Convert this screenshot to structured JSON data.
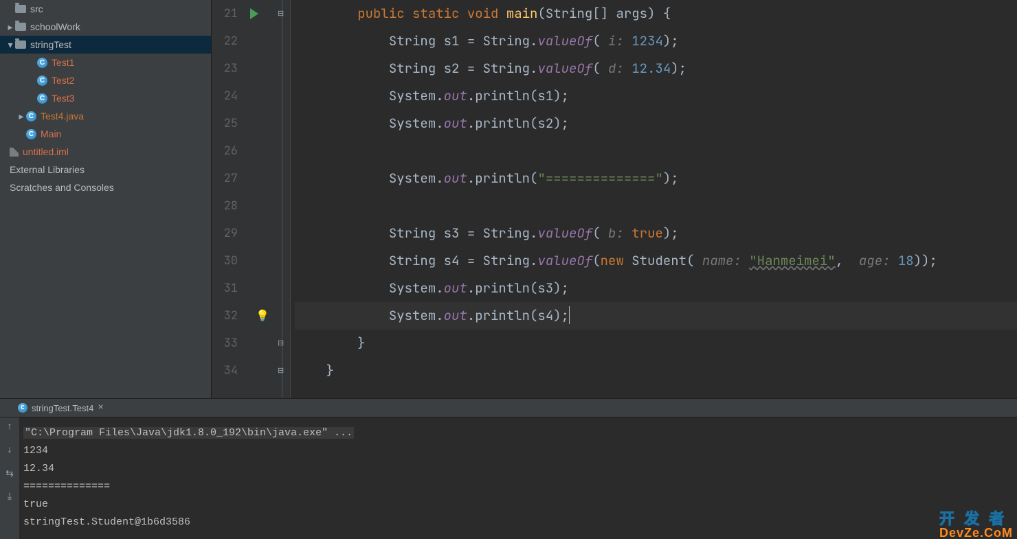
{
  "tree": {
    "items": [
      {
        "indent": 0,
        "arrow": "",
        "icon": "folder",
        "label": "src",
        "class": "plain"
      },
      {
        "indent": 0,
        "arrow": "▸",
        "icon": "folder",
        "label": "schoolWork",
        "class": "plain"
      },
      {
        "indent": 0,
        "arrow": "▾",
        "icon": "folder",
        "label": "stringTest",
        "class": "plain",
        "selected": true
      },
      {
        "indent": 2,
        "arrow": "",
        "icon": "cfile",
        "label": "Test1",
        "class": "fname"
      },
      {
        "indent": 2,
        "arrow": "",
        "icon": "cfile",
        "label": "Test2",
        "class": "fname"
      },
      {
        "indent": 2,
        "arrow": "",
        "icon": "cfile",
        "label": "Test3",
        "class": "fname"
      },
      {
        "indent": 1,
        "arrow": "▸",
        "icon": "cfile",
        "label": "Test4.java",
        "class": "fname2"
      },
      {
        "indent": 1,
        "arrow": "",
        "icon": "cfile",
        "label": "Main",
        "class": "fname"
      },
      {
        "indent": 0,
        "arrow": "",
        "icon": "iml",
        "label": "untitled.iml",
        "class": "fname",
        "outdent": true
      },
      {
        "indent": 0,
        "arrow": "",
        "icon": "",
        "label": "External Libraries",
        "class": "plain",
        "outdent": true
      },
      {
        "indent": 0,
        "arrow": "",
        "icon": "",
        "label": "Scratches and Consoles",
        "class": "plain",
        "outdent": true
      }
    ]
  },
  "lines": {
    "start": 21,
    "count": 14,
    "run_at": 21,
    "bulb_at": 32,
    "cursor_at": 32
  },
  "code": {
    "ws8": "        ",
    "ws12": "            ",
    "l21a": "public",
    "l21b": " ",
    "l21c": "static",
    "l21d": " ",
    "l21e": "void",
    "l21f": " ",
    "l21g": "main",
    "l21h": "(String[] args) {",
    "l22a": "String s1 = String.",
    "l22b": "valueOf",
    "l22c": "( ",
    "l22d": "i:",
    "l22e": " ",
    "l22f": "1234",
    "l22g": ");",
    "l23a": "String s2 = String.",
    "l23b": "valueOf",
    "l23c": "( ",
    "l23d": "d:",
    "l23e": " ",
    "l23f": "12.34",
    "l23g": ");",
    "l24a": "System.",
    "l24b": "out",
    "l24c": ".println(s1);",
    "l25a": "System.",
    "l25b": "out",
    "l25c": ".println(s2);",
    "l27a": "System.",
    "l27b": "out",
    "l27c": ".println(",
    "l27d": "\"==============\"",
    "l27e": ");",
    "l29a": "String s3 = String.",
    "l29b": "valueOf",
    "l29c": "( ",
    "l29d": "b:",
    "l29e": " ",
    "l29f": "true",
    "l29g": ");",
    "l30a": "String s4 = String.",
    "l30b": "valueOf",
    "l30c": "(",
    "l30d": "new",
    "l30e": " Student( ",
    "l30f": "name:",
    "l30g": " ",
    "l30h": "\"Hanmeimei\"",
    "l30i": ",  ",
    "l30j": "age:",
    "l30k": " ",
    "l30l": "18",
    "l30m": "));",
    "l31a": "System.",
    "l31b": "out",
    "l31c": ".println(s3);",
    "l32a": "System.",
    "l32b": "out",
    "l32c": ".println(s4);",
    "l33": "}",
    "l34": "}"
  },
  "tab": {
    "label": "stringTest.Test4"
  },
  "console": {
    "cmd": "\"C:\\Program Files\\Java\\jdk1.8.0_192\\bin\\java.exe\" ...",
    "lines": [
      "1234",
      "12.34",
      "==============",
      "true",
      "stringTest.Student@1b6d3586"
    ]
  },
  "watermark": {
    "l1": "开 发 者",
    "l2": "DevZe.CoM"
  }
}
